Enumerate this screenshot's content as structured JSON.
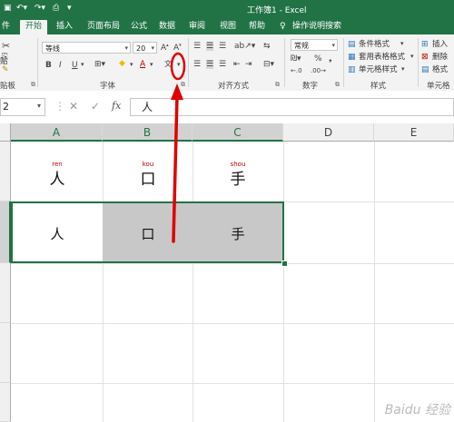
{
  "title": {
    "text": "工作簿1 - Excel"
  },
  "tabs": [
    {
      "label": "件"
    },
    {
      "label": "开始"
    },
    {
      "label": "插入"
    },
    {
      "label": "页面布局"
    },
    {
      "label": "公式"
    },
    {
      "label": "数据"
    },
    {
      "label": "审阅"
    },
    {
      "label": "视图"
    },
    {
      "label": "帮助"
    },
    {
      "label": "操作说明搜索"
    }
  ],
  "ribbon": {
    "clipboard_group": "贴板",
    "paste_label": "贴",
    "font_name": "等线",
    "font_size": "20",
    "font_group": "字体",
    "bold": "B",
    "italic": "I",
    "underline": "U",
    "font_color_letter": "A",
    "align_group": "对齐方式",
    "number_format": "常规",
    "number_group": "数字",
    "cond_format": "条件格式",
    "table_format": "套用表格格式",
    "cell_style": "单元格样式",
    "styles_group": "样式",
    "insert": "插入",
    "delete": "删除",
    "format": "格式",
    "cells_group": "单元格"
  },
  "formula_bar": {
    "name_box": "2",
    "fx": "fx",
    "content": "人"
  },
  "columns": [
    "A",
    "B",
    "C",
    "D",
    "E"
  ],
  "cells": {
    "r1": [
      {
        "pinyin": "ren",
        "char": "人"
      },
      {
        "pinyin": "kou",
        "char": "口"
      },
      {
        "pinyin": "shou",
        "char": "手"
      }
    ],
    "r2": [
      {
        "char": "人"
      },
      {
        "char": "口"
      },
      {
        "char": "手"
      }
    ]
  },
  "colors": {
    "excel_green": "#217346",
    "selected_fill": "#c8c8c8",
    "annotation_red": "#e00000"
  },
  "watermark": "Baidu 经验"
}
